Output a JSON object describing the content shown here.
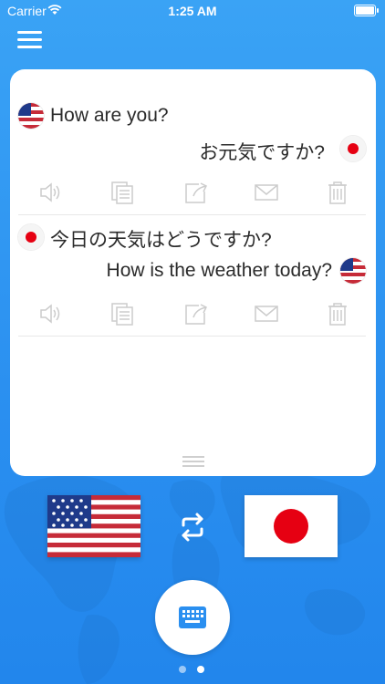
{
  "status_bar": {
    "carrier": "Carrier",
    "time": "1:25 AM"
  },
  "header": {
    "menu_icon": "hamburger-menu-icon"
  },
  "translations": [
    {
      "source_text": "How are you?",
      "source_lang_icon": "us-flag-icon",
      "target_text": "お元気ですか?",
      "target_lang_icon": "japan-flag-icon"
    },
    {
      "source_text": "今日の天気はどうですか?",
      "source_lang_icon": "japan-flag-icon",
      "target_text": "How is the weather today?",
      "target_lang_icon": "us-flag-icon"
    }
  ],
  "actions": [
    "speaker-icon",
    "copy-icon",
    "share-icon",
    "mail-icon",
    "trash-icon"
  ],
  "language_selector": {
    "source_icon": "us-flag-icon",
    "swap_icon": "swap-arrows-icon",
    "target_icon": "japan-flag-icon"
  },
  "keyboard_button_icon": "keyboard-icon",
  "page_dots": {
    "count": 2,
    "active": 1
  },
  "colors": {
    "background": "#2a8ff0",
    "card": "#ffffff",
    "icon_gray": "#cccccc",
    "japan_red": "#e60012",
    "us_red": "#c62b38",
    "us_blue": "#1f3a8a",
    "keyboard_blue": "#2a8ff0"
  }
}
